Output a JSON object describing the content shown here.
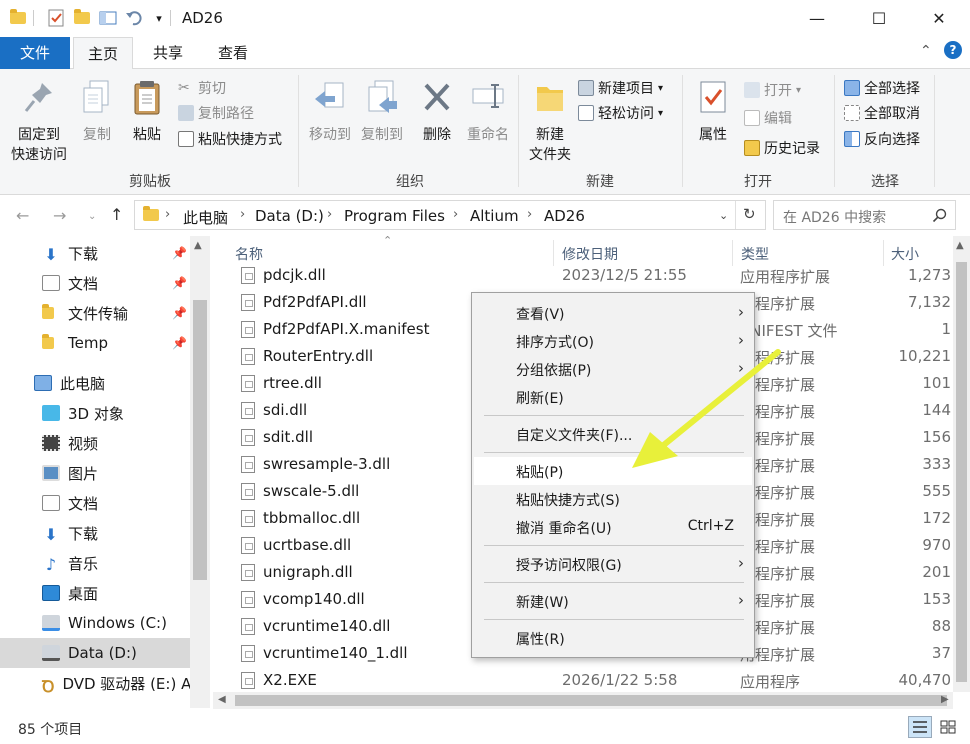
{
  "window": {
    "title": "AD26"
  },
  "quick_access": {
    "dropdown": "▾"
  },
  "window_controls": {
    "minimize": "—",
    "maximize": "☐",
    "close": "✕"
  },
  "tabs": [
    {
      "label": "文件"
    },
    {
      "label": "主页"
    },
    {
      "label": "共享"
    },
    {
      "label": "查看"
    }
  ],
  "ribbon": {
    "clipboard": {
      "pin_label_1": "固定到",
      "pin_label_2": "快速访问",
      "copy": "复制",
      "paste": "粘贴",
      "cut": "剪切",
      "copy_path": "复制路径",
      "paste_shortcut": "粘贴快捷方式",
      "group": "剪贴板"
    },
    "organize": {
      "move_to": "移动到",
      "copy_to": "复制到",
      "delete": "删除",
      "rename": "重命名",
      "group": "组织"
    },
    "new": {
      "new_folder_1": "新建",
      "new_folder_2": "文件夹",
      "new_item": "新建项目",
      "easy_access": "轻松访问",
      "group": "新建"
    },
    "open": {
      "properties": "属性",
      "open": "打开",
      "edit": "编辑",
      "history": "历史记录",
      "group": "打开"
    },
    "select": {
      "select_all": "全部选择",
      "select_none": "全部取消",
      "invert": "反向选择",
      "group": "选择"
    }
  },
  "address": {
    "crumbs": [
      "此电脑",
      "Data (D:)",
      "Program Files",
      "Altium",
      "AD26"
    ],
    "search_placeholder": "在 AD26 中搜索"
  },
  "nav_pane": {
    "quick": [
      {
        "label": "下载",
        "icon": "download-arrow-icon",
        "pinned": true
      },
      {
        "label": "文档",
        "icon": "document-icon",
        "pinned": true
      },
      {
        "label": "文件传输",
        "icon": "folder-icon",
        "pinned": true
      },
      {
        "label": "Temp",
        "icon": "folder-icon",
        "pinned": true
      }
    ],
    "this_pc": "此电脑",
    "pc_items": [
      {
        "label": "3D 对象",
        "icon": "cube-icon"
      },
      {
        "label": "视频",
        "icon": "video-icon"
      },
      {
        "label": "图片",
        "icon": "picture-icon"
      },
      {
        "label": "文档",
        "icon": "document-icon"
      },
      {
        "label": "下载",
        "icon": "download-arrow-icon"
      },
      {
        "label": "音乐",
        "icon": "music-icon"
      },
      {
        "label": "桌面",
        "icon": "desktop-icon"
      },
      {
        "label": "Windows (C:)",
        "icon": "drive-icon"
      },
      {
        "label": "Data (D:)",
        "icon": "drive-icon"
      },
      {
        "label": "DVD 驱动器 (E:) A",
        "icon": "dvd-icon"
      }
    ]
  },
  "list": {
    "headers": {
      "name": "名称",
      "date": "修改日期",
      "type": "类型",
      "size": "大小"
    },
    "rows": [
      {
        "name": "pdcjk.dll",
        "date": "2023/12/5 21:55",
        "type": "应用程序扩展",
        "size": "1,273"
      },
      {
        "name": "Pdf2PdfAPI.dll",
        "date": "",
        "type": "用程序扩展",
        "size": "7,132"
      },
      {
        "name": "Pdf2PdfAPI.X.manifest",
        "date": "",
        "type": "ANIFEST 文件",
        "size": "1"
      },
      {
        "name": "RouterEntry.dll",
        "date": "",
        "type": "用程序扩展",
        "size": "10,221"
      },
      {
        "name": "rtree.dll",
        "date": "",
        "type": "用程序扩展",
        "size": "101"
      },
      {
        "name": "sdi.dll",
        "date": "",
        "type": "用程序扩展",
        "size": "144"
      },
      {
        "name": "sdit.dll",
        "date": "",
        "type": "用程序扩展",
        "size": "156"
      },
      {
        "name": "swresample-3.dll",
        "date": "",
        "type": "用程序扩展",
        "size": "333"
      },
      {
        "name": "swscale-5.dll",
        "date": "",
        "type": "用程序扩展",
        "size": "555"
      },
      {
        "name": "tbbmalloc.dll",
        "date": "",
        "type": "用程序扩展",
        "size": "172"
      },
      {
        "name": "ucrtbase.dll",
        "date": "",
        "type": "用程序扩展",
        "size": "970"
      },
      {
        "name": "unigraph.dll",
        "date": "",
        "type": "用程序扩展",
        "size": "201"
      },
      {
        "name": "vcomp140.dll",
        "date": "",
        "type": "用程序扩展",
        "size": "153"
      },
      {
        "name": "vcruntime140.dll",
        "date": "",
        "type": "用程序扩展",
        "size": "88"
      },
      {
        "name": "vcruntime140_1.dll",
        "date": "",
        "type": "用程序扩展",
        "size": "37"
      },
      {
        "name": "X2.EXE",
        "date": "2026/1/22 5:58",
        "type": "应用程序",
        "size": "40,470"
      }
    ]
  },
  "context_menu": [
    {
      "label": "查看(V)",
      "arrow": true
    },
    {
      "label": "排序方式(O)",
      "arrow": true
    },
    {
      "label": "分组依据(P)",
      "arrow": true
    },
    {
      "label": "刷新(E)"
    },
    {
      "label": "自定义文件夹(F)..."
    },
    {
      "label": "粘贴(P)",
      "highlight": true
    },
    {
      "label": "粘贴快捷方式(S)"
    },
    {
      "label": "撤消 重命名(U)",
      "shortcut": "Ctrl+Z"
    },
    {
      "label": "授予访问权限(G)",
      "arrow": true
    },
    {
      "label": "新建(W)",
      "arrow": true
    },
    {
      "label": "属性(R)"
    }
  ],
  "status": {
    "count": "85 个项目"
  },
  "colors": {
    "accent": "#1a6fc4",
    "annotation_arrow": "#e8f03a",
    "folder": "#f2c94c"
  }
}
